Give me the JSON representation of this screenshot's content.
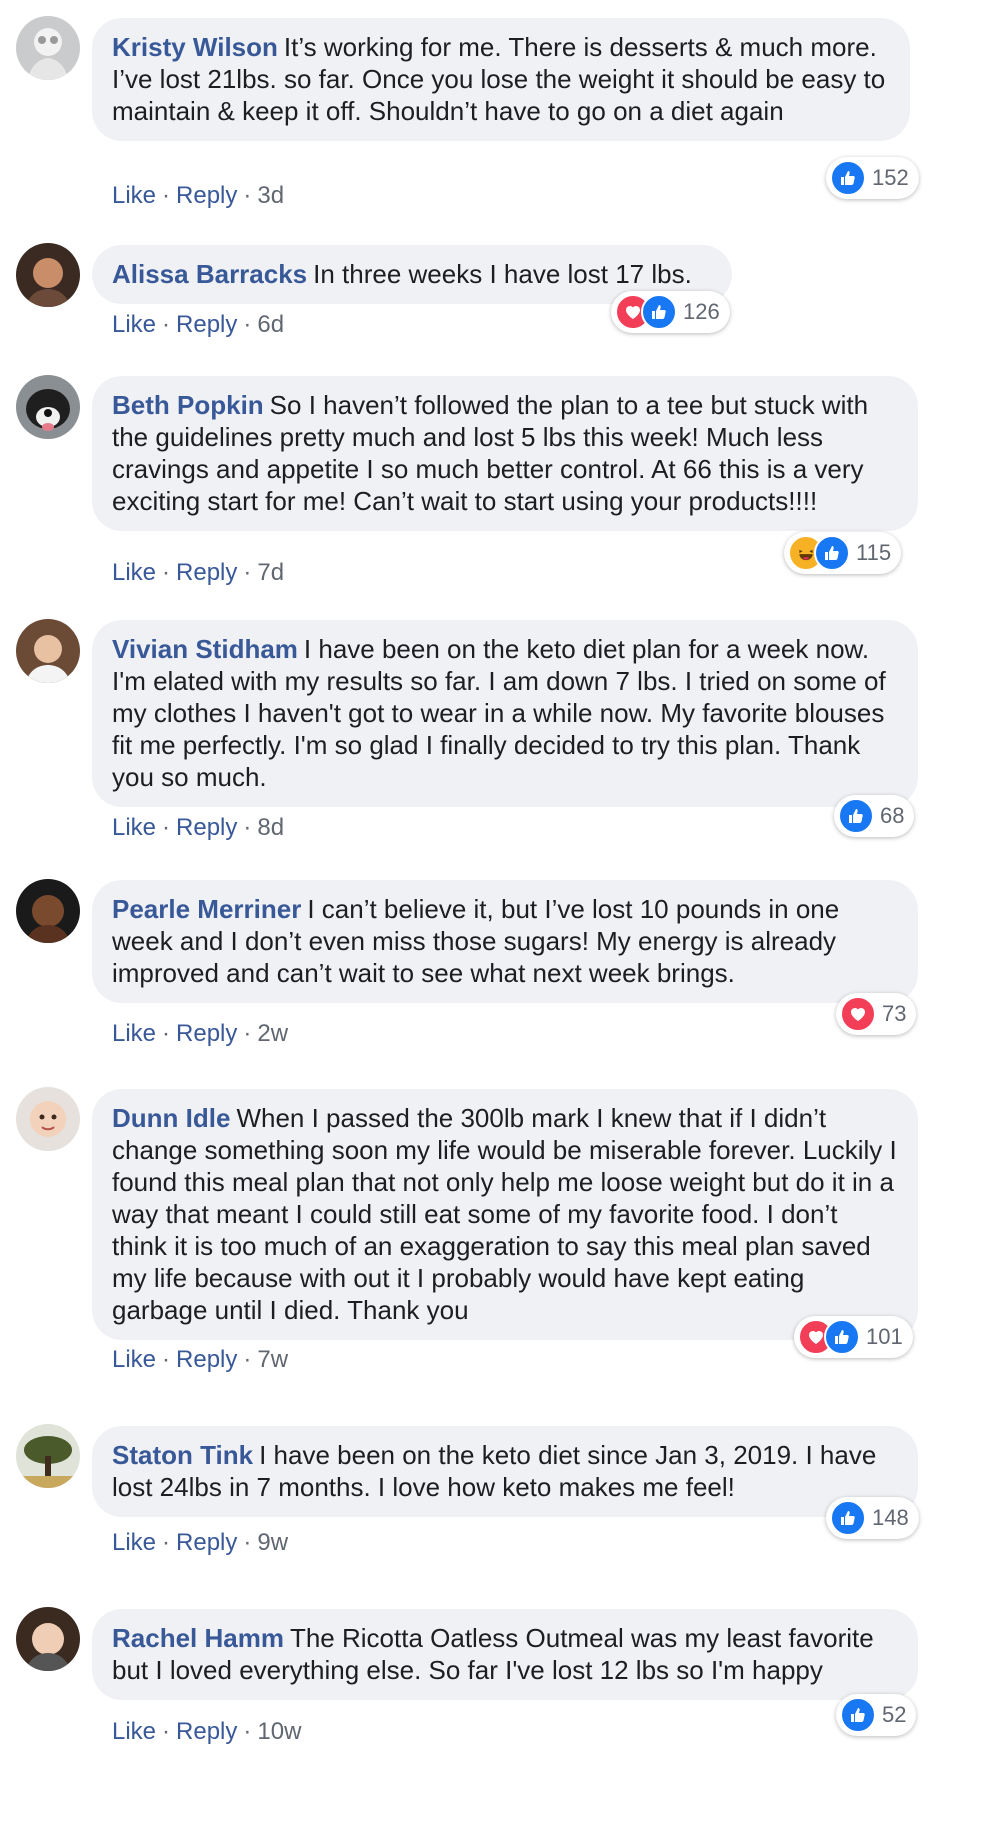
{
  "reaction_colors": {
    "like": "#1877f2",
    "love": "#f33e58",
    "haha": "#f7b125"
  },
  "action_labels": {
    "like": "Like",
    "reply": "Reply"
  },
  "comments": [
    {
      "author": "Kristy Wilson",
      "text": "It’s working for me. There is desserts & much more. I’ve lost 21lbs. so far. Once you lose the weight it should be easy to maintain & keep it off. Shouldn’t have to go on a diet again",
      "time": "3d",
      "reactions": [
        "like"
      ],
      "count": "152"
    },
    {
      "author": "Alissa Barracks",
      "text": "In three weeks I have lost 17 lbs.",
      "time": "6d",
      "reactions": [
        "love",
        "like"
      ],
      "count": "126"
    },
    {
      "author": "Beth Popkin",
      "text": "So I haven’t followed the plan to a tee but stuck with the guidelines pretty much and lost 5 lbs this week! Much less cravings and appetite I so much better control. At 66 this is a very exciting start for me! Can’t wait to start using your products!!!!",
      "time": "7d",
      "reactions": [
        "haha",
        "like"
      ],
      "count": "115"
    },
    {
      "author": "Vivian Stidham",
      "text": "I have been on the keto diet plan for a week now. I'm elated with my results so far. I am down 7 lbs. I tried on some of my clothes I haven't got to wear in a while now. My favorite blouses fit me perfectly. I'm so glad I finally decided to try this plan. Thank you so much.",
      "time": "8d",
      "reactions": [
        "like"
      ],
      "count": "68"
    },
    {
      "author": "Pearle Merriner",
      "text": "I can’t believe it, but I’ve lost 10 pounds in one week and I don’t even miss those sugars! My energy is already improved and can’t wait to see what next week brings.",
      "time": "2w",
      "reactions": [
        "love"
      ],
      "count": "73"
    },
    {
      "author": "Dunn Idle",
      "text": "When I passed the 300lb mark I knew that if I didn’t change something soon my life would be miserable forever. Luckily I found this meal plan that not only help me loose weight but do it in a way that meant I could still eat some of my favorite food. I don’t think it is too much of an exaggeration to say this meal plan saved my life because with out it I probably would have kept eating garbage until I died. Thank you",
      "time": "7w",
      "reactions": [
        "love",
        "like"
      ],
      "count": "101"
    },
    {
      "author": "Staton Tink",
      "text": "I have been on the keto diet since Jan 3, 2019. I have lost 24lbs in 7 months. I love how keto makes me feel!",
      "time": "9w",
      "reactions": [
        "like"
      ],
      "count": "148"
    },
    {
      "author": "Rachel Hamm",
      "text": "The Ricotta Oatless Outmeal was my least favorite but I loved everything else. So far I've lost 12 lbs so I'm happy",
      "time": "10w",
      "reactions": [
        "like"
      ],
      "count": "52"
    }
  ]
}
